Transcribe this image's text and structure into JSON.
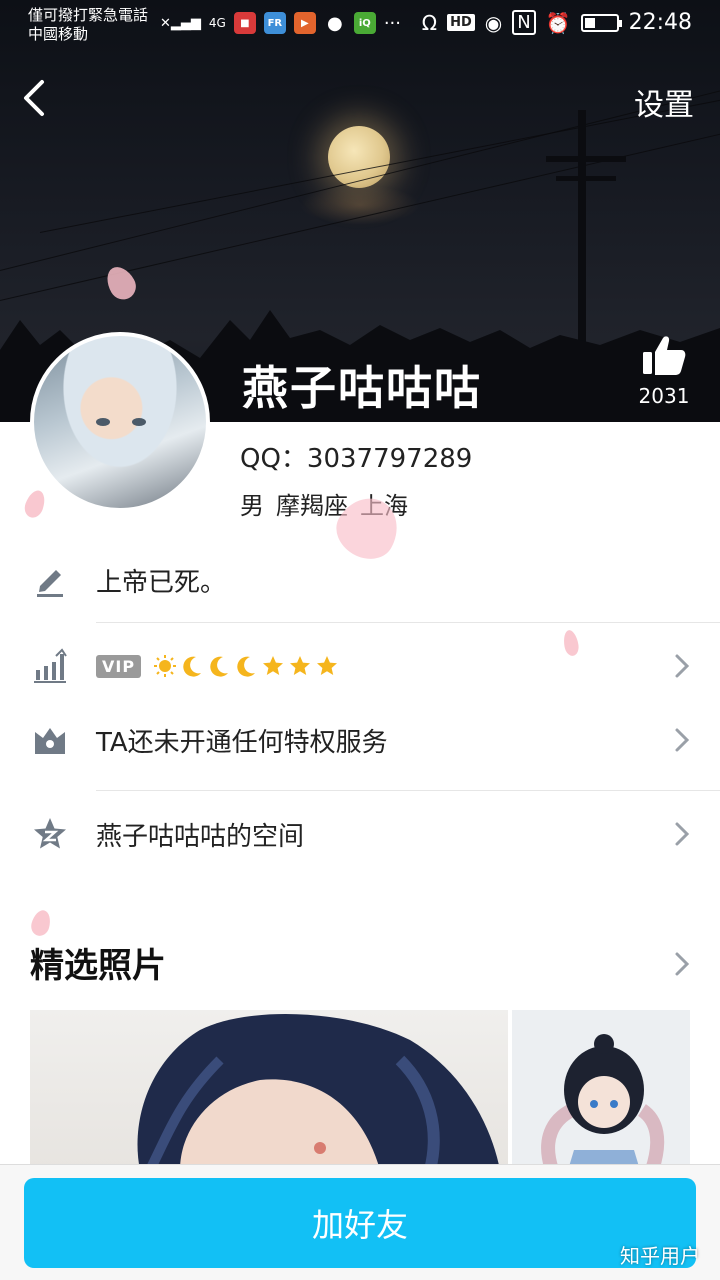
{
  "status_bar": {
    "carrier_line1": "僅可撥打緊急電話",
    "carrier_line2": "中國移動",
    "network": "4G",
    "time": "22:48",
    "hd_label": "HD",
    "nfc_label": "N"
  },
  "header": {
    "settings_label": "设置"
  },
  "profile": {
    "name": "燕子咕咕咕",
    "likes": "2031",
    "qq": "QQ：3037797289",
    "gender": "男",
    "zodiac": "摩羯座",
    "location": "上海"
  },
  "rows": {
    "signature": "上帝已死。",
    "vip_badge": "VIP",
    "level_icons": [
      "sun",
      "moon",
      "moon",
      "moon",
      "star",
      "star",
      "star"
    ],
    "privilege": "TA还未开通任何特权服务",
    "space": "燕子咕咕咕的空间"
  },
  "photos": {
    "section_title": "精选照片"
  },
  "footer": {
    "add_friend": "加好友",
    "watermark": "知乎用户"
  },
  "colors": {
    "accent": "#12c0f5",
    "icon_gray": "#707a86",
    "vip_gray": "#9a9a9a"
  }
}
